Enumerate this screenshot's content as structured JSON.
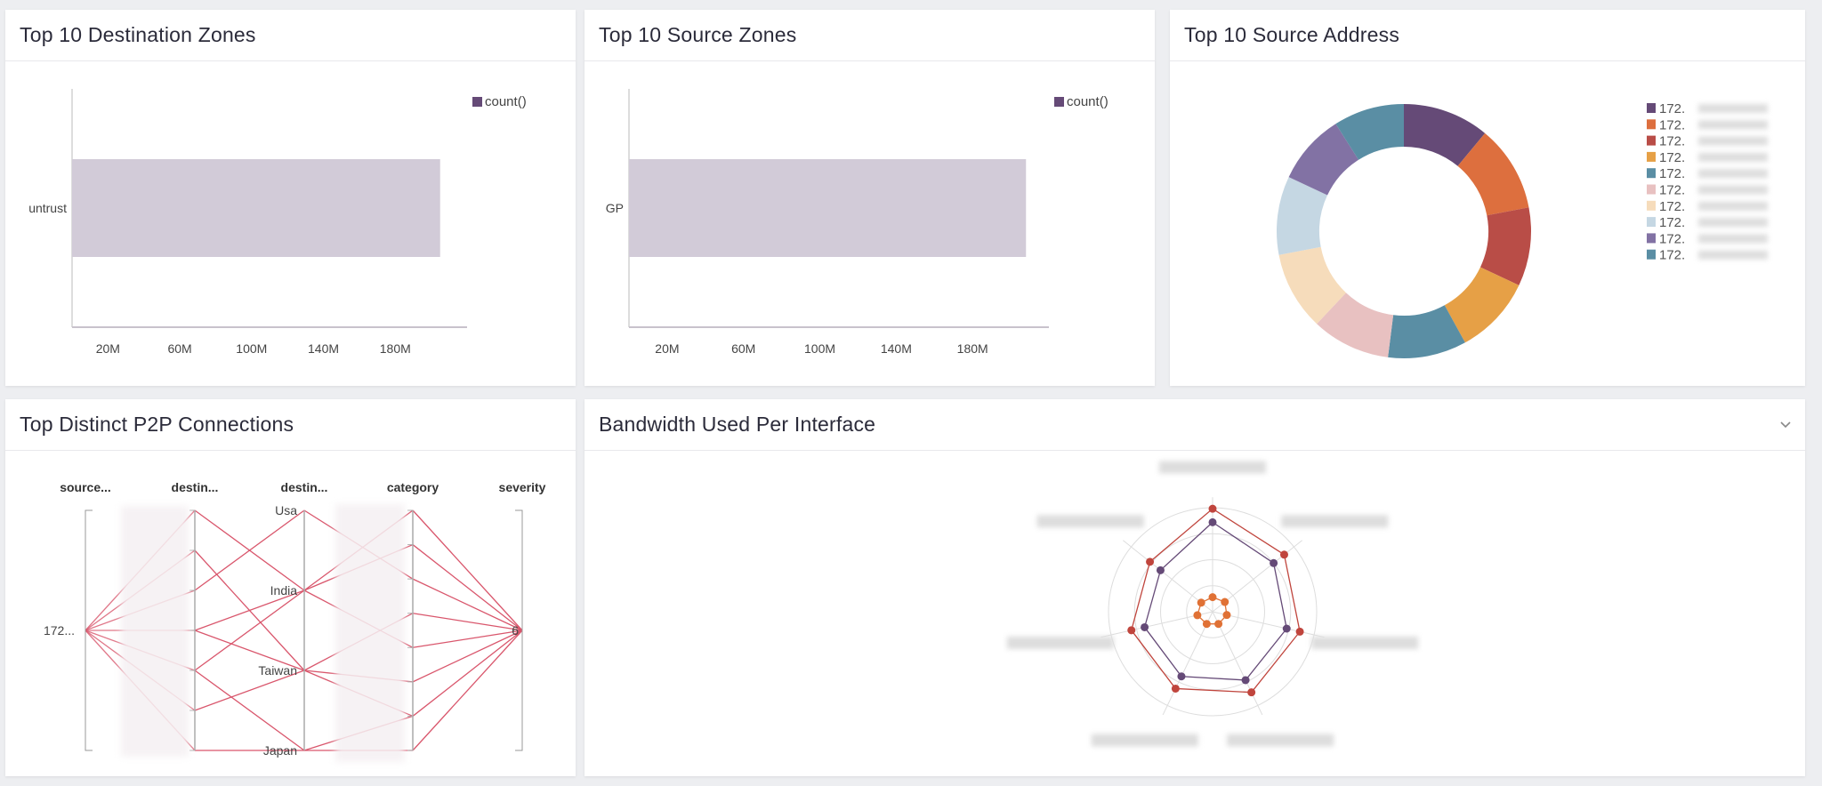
{
  "panels": {
    "dest_zones": {
      "title": "Top 10 Destination Zones"
    },
    "src_zones": {
      "title": "Top 10 Source Zones"
    },
    "src_address": {
      "title": "Top 10 Source Address"
    },
    "p2p": {
      "title": "Top Distinct P2P Connections"
    },
    "bandwidth": {
      "title": "Bandwidth Used Per Interface",
      "menu_icon": "chevron-down-icon"
    }
  },
  "colors": {
    "bar": "#d2cbd8",
    "legend_swatch": "#654a77",
    "p2p_line": "#d9566c",
    "radar_red": "#c0453d",
    "radar_purple": "#654a77",
    "radar_orange": "#e07135"
  },
  "chart_data": [
    {
      "type": "bar",
      "orientation": "horizontal",
      "categories": [
        "untrust"
      ],
      "series": [
        {
          "name": "count()",
          "values": [
            205000000
          ]
        }
      ],
      "xticks": [
        "20M",
        "60M",
        "100M",
        "140M",
        "180M"
      ],
      "xlim": [
        0,
        220000000
      ],
      "legend": "top-right"
    },
    {
      "type": "bar",
      "orientation": "horizontal",
      "categories": [
        "GP"
      ],
      "series": [
        {
          "name": "count()",
          "values": [
            208000000
          ]
        }
      ],
      "xticks": [
        "20M",
        "60M",
        "100M",
        "140M",
        "180M"
      ],
      "xlim": [
        0,
        220000000
      ],
      "legend": "top-right"
    },
    {
      "type": "pie",
      "donut": true,
      "legend": "right",
      "labels": [
        "172.",
        "172.",
        "172.",
        "172.",
        "172.",
        "172.",
        "172.",
        "172.",
        "172.",
        "172."
      ],
      "values": [
        11,
        11,
        10,
        10,
        10,
        10,
        10,
        10,
        9,
        9
      ],
      "colors": [
        "#654a77",
        "#dd6f3e",
        "#b94d47",
        "#e6a046",
        "#5a8ea4",
        "#e8c1c1",
        "#f6dcbb",
        "#c5d7e3",
        "#8272a4",
        "#5a8ea4"
      ]
    },
    {
      "type": "parallel",
      "axes": [
        "source...",
        "destin...",
        "destin...",
        "category",
        "severity"
      ],
      "axis_values": {
        "source": [
          "172..."
        ],
        "destination_country": [
          "Usa",
          "India",
          "Taiwan",
          "Japan"
        ],
        "severity": [
          "6"
        ]
      },
      "links_dest_to_country": [
        [
          0,
          "India"
        ],
        [
          1,
          "Taiwan"
        ],
        [
          2,
          "Usa"
        ],
        [
          3,
          "India"
        ],
        [
          3,
          "Taiwan"
        ],
        [
          4,
          "India"
        ],
        [
          4,
          "Japan"
        ],
        [
          5,
          "Taiwan"
        ],
        [
          6,
          "Japan"
        ]
      ],
      "dest_count": 7,
      "category_count": 8
    },
    {
      "type": "radar",
      "axes_count": 7,
      "rmax": 1,
      "rings": 4,
      "series": [
        {
          "color": "#c0453d",
          "values": [
            0.99,
            0.88,
            0.86,
            0.86,
            0.82,
            0.8,
            0.77
          ]
        },
        {
          "color": "#654a77",
          "values": [
            0.86,
            0.75,
            0.73,
            0.73,
            0.69,
            0.67,
            0.64
          ]
        },
        {
          "color": "#e07135",
          "values": [
            0.14,
            0.15,
            0.14,
            0.13,
            0.13,
            0.15,
            0.14
          ]
        }
      ]
    }
  ]
}
